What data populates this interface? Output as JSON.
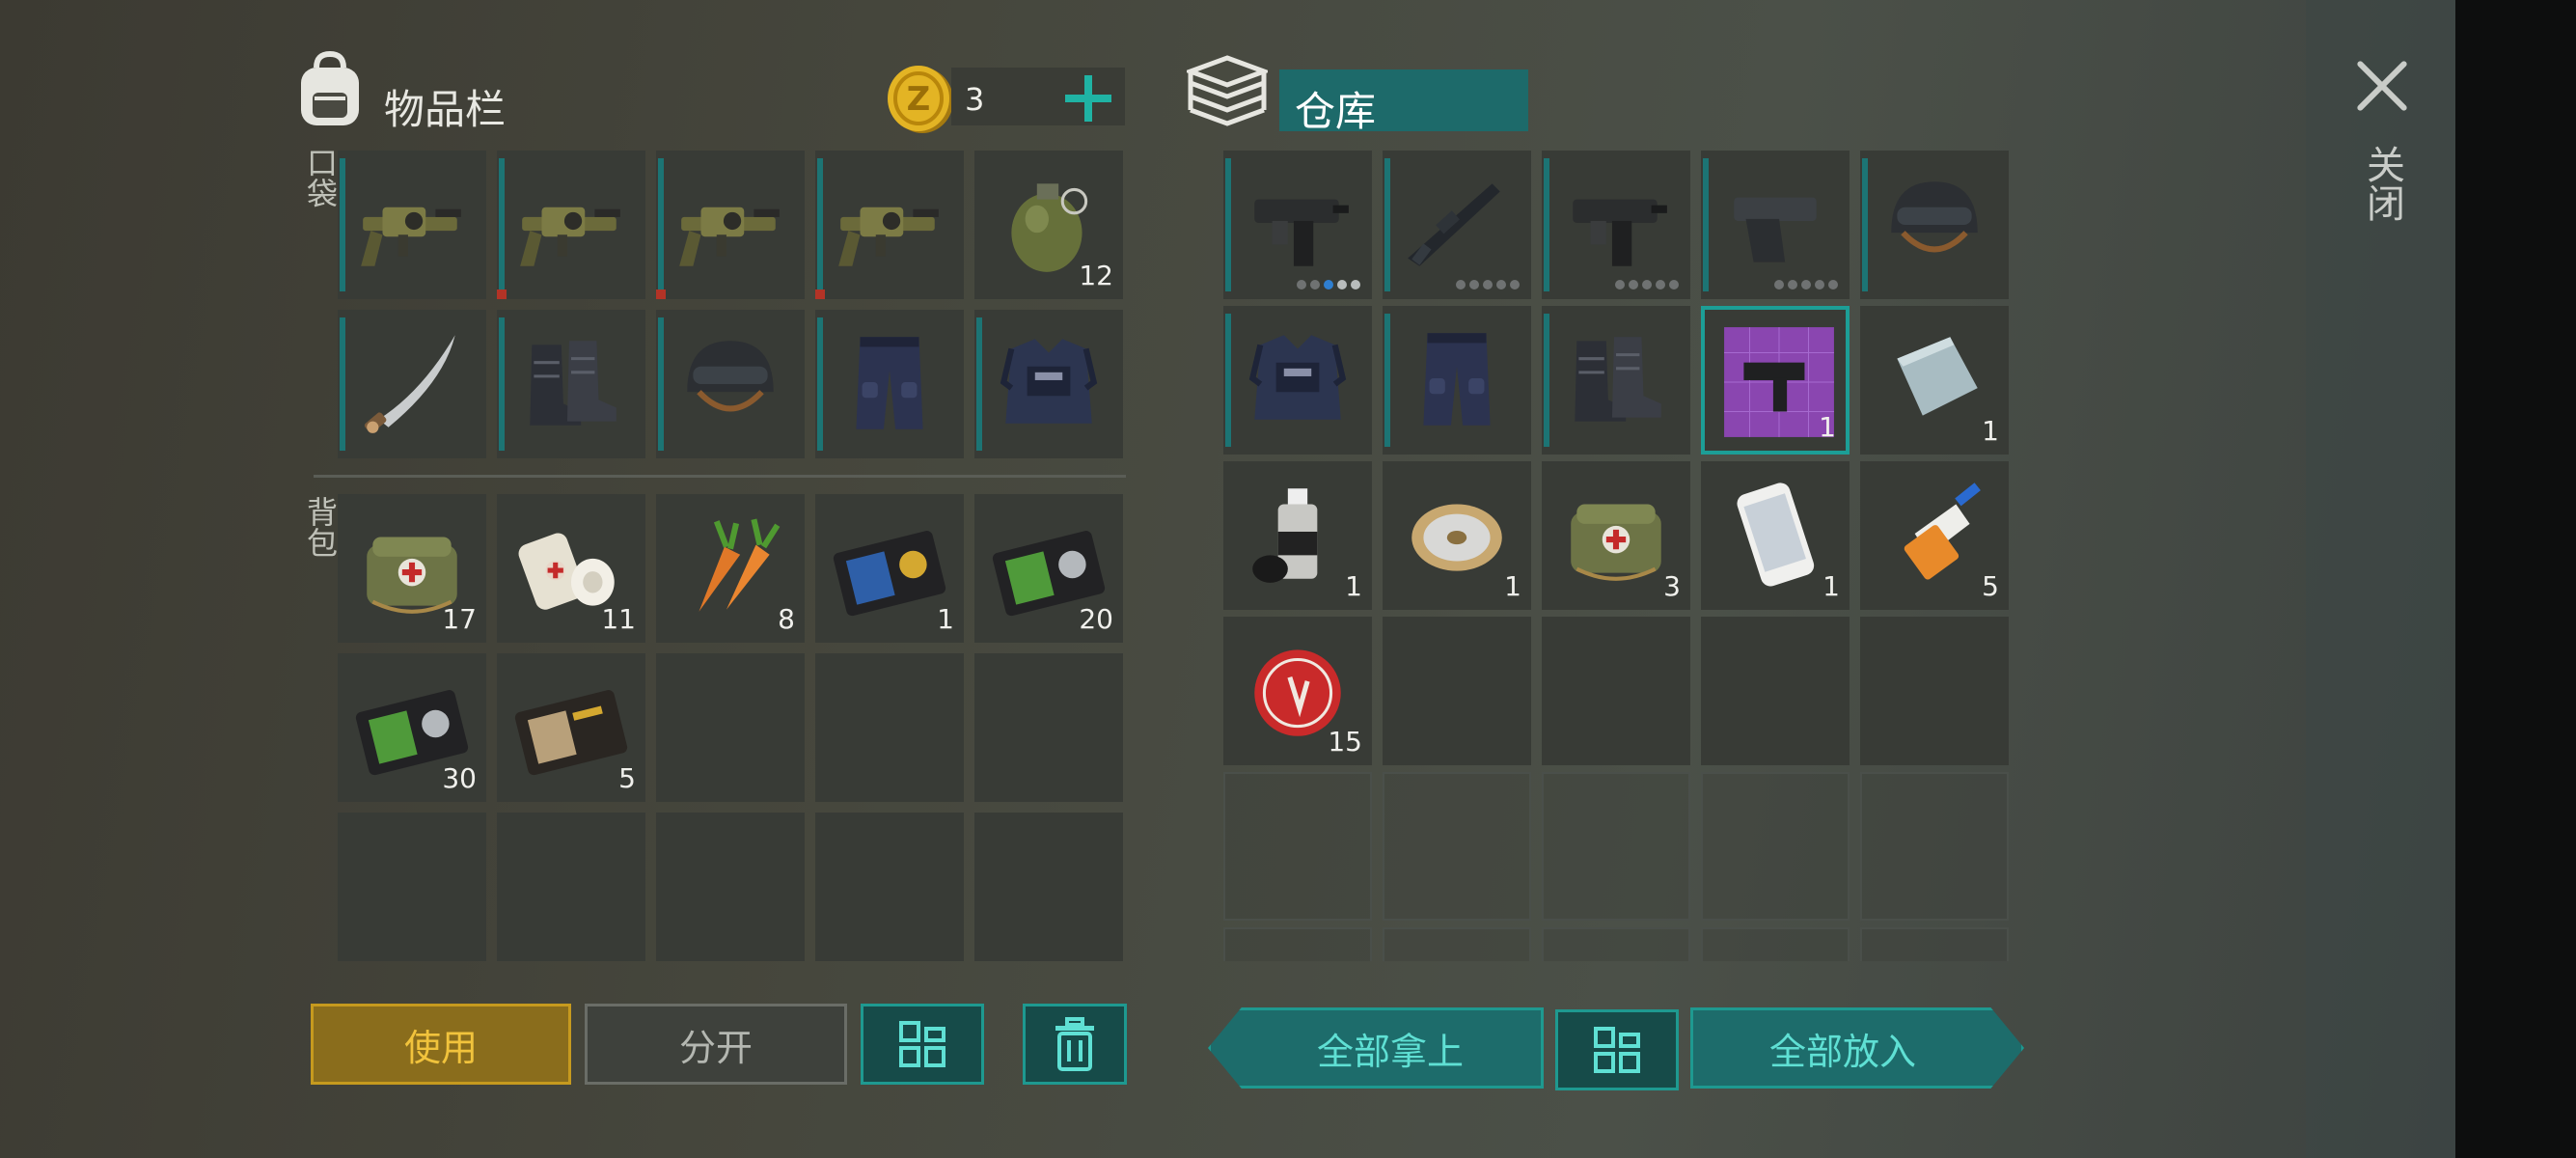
{
  "inventory": {
    "title": "物品栏",
    "coin_count": "3",
    "pocket_label": "口袋",
    "backpack_label": "背包",
    "pockets": [
      {
        "icon": "grenade-launcher-icon",
        "qty": "",
        "bar": true,
        "red": false
      },
      {
        "icon": "grenade-launcher-icon",
        "qty": "",
        "bar": true,
        "red": true
      },
      {
        "icon": "grenade-launcher-icon",
        "qty": "",
        "bar": true,
        "red": true
      },
      {
        "icon": "grenade-launcher-icon",
        "qty": "",
        "bar": true,
        "red": true
      },
      {
        "icon": "grenade-icon",
        "qty": "12",
        "bar": false,
        "red": false
      },
      {
        "icon": "machete-icon",
        "qty": "",
        "bar": true,
        "red": false
      },
      {
        "icon": "boots-icon",
        "qty": "",
        "bar": true,
        "red": false
      },
      {
        "icon": "helmet-icon",
        "qty": "",
        "bar": true,
        "red": false
      },
      {
        "icon": "pants-icon",
        "qty": "",
        "bar": true,
        "red": false
      },
      {
        "icon": "vest-icon",
        "qty": "",
        "bar": true,
        "red": false
      }
    ],
    "backpack": [
      {
        "icon": "medkit-bag-icon",
        "qty": "17"
      },
      {
        "icon": "bandage-icon",
        "qty": "11"
      },
      {
        "icon": "carrot-icon",
        "qty": "8"
      },
      {
        "icon": "badge-blue-icon",
        "qty": "1"
      },
      {
        "icon": "badge-green-icon",
        "qty": "20"
      },
      {
        "icon": "badge-green-icon",
        "qty": "30"
      },
      {
        "icon": "patrol-badge-icon",
        "qty": "5"
      },
      {
        "icon": "",
        "qty": ""
      },
      {
        "icon": "",
        "qty": ""
      },
      {
        "icon": "",
        "qty": ""
      },
      {
        "icon": "",
        "qty": ""
      },
      {
        "icon": "",
        "qty": ""
      },
      {
        "icon": "",
        "qty": ""
      },
      {
        "icon": "",
        "qty": ""
      },
      {
        "icon": "",
        "qty": ""
      }
    ]
  },
  "storage": {
    "title": "仓库",
    "items": [
      {
        "icon": "uzi-icon",
        "qty": "",
        "bar": true,
        "dots": [
          0,
          0,
          1,
          2,
          2
        ]
      },
      {
        "icon": "rifle-icon",
        "qty": "",
        "bar": true,
        "dots": [
          0,
          0,
          0,
          0,
          0
        ]
      },
      {
        "icon": "uzi-icon",
        "qty": "",
        "bar": true,
        "dots": [
          0,
          0,
          0,
          0,
          0
        ]
      },
      {
        "icon": "pistol-icon",
        "qty": "",
        "bar": true,
        "dots": [
          0,
          0,
          0,
          0,
          0
        ]
      },
      {
        "icon": "helmet-icon",
        "qty": "",
        "bar": true
      },
      {
        "icon": "vest-icon",
        "qty": "",
        "bar": true
      },
      {
        "icon": "pants-icon",
        "qty": "",
        "bar": true
      },
      {
        "icon": "boots-icon",
        "qty": "",
        "bar": true
      },
      {
        "icon": "uzi-blueprint-icon",
        "qty": "1",
        "sel": true
      },
      {
        "icon": "metal-plate-icon",
        "qty": "1"
      },
      {
        "icon": "spray-paint-icon",
        "qty": "1"
      },
      {
        "icon": "wire-spool-icon",
        "qty": "1"
      },
      {
        "icon": "medkit-bag-icon",
        "qty": "3"
      },
      {
        "icon": "smartphone-icon",
        "qty": "1"
      },
      {
        "icon": "glue-icon",
        "qty": "5"
      },
      {
        "icon": "bottle-cap-icon",
        "qty": "15"
      },
      {
        "icon": "",
        "qty": ""
      },
      {
        "icon": "",
        "qty": ""
      },
      {
        "icon": "",
        "qty": ""
      },
      {
        "icon": "",
        "qty": ""
      },
      {
        "icon": "",
        "qty": "",
        "ghost": true
      },
      {
        "icon": "",
        "qty": "",
        "ghost": true
      },
      {
        "icon": "",
        "qty": "",
        "ghost": true
      },
      {
        "icon": "",
        "qty": "",
        "ghost": true
      },
      {
        "icon": "",
        "qty": "",
        "ghost": true
      },
      {
        "icon": "",
        "qty": "",
        "ghost": true
      },
      {
        "icon": "",
        "qty": "",
        "ghost": true
      },
      {
        "icon": "",
        "qty": "",
        "ghost": true
      },
      {
        "icon": "",
        "qty": "",
        "ghost": true
      },
      {
        "icon": "",
        "qty": "",
        "ghost": true
      }
    ]
  },
  "buttons": {
    "use": "使用",
    "split": "分开",
    "take_all": "全部拿上",
    "put_all": "全部放入"
  },
  "close_label": "关闭",
  "colors": {
    "accent": "#1e9990",
    "use": "#c69a1e",
    "coin": "#e0b020"
  }
}
